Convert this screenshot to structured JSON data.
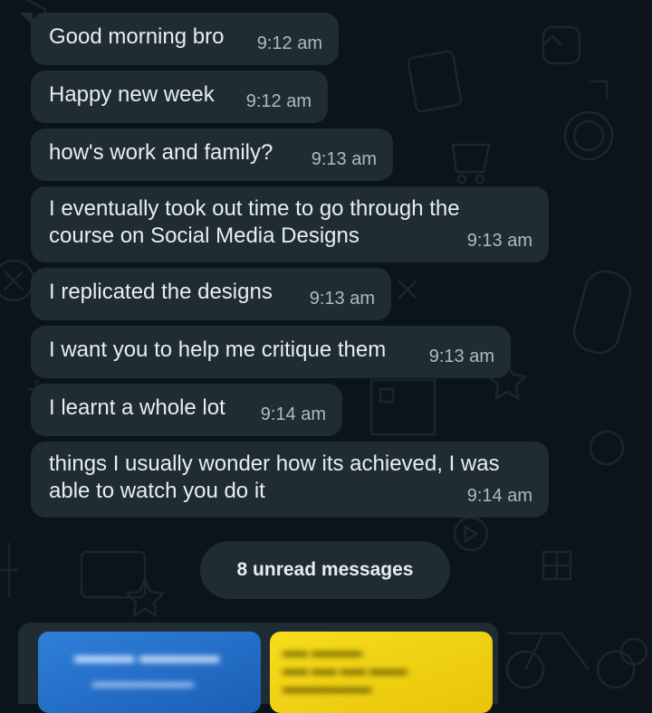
{
  "messages": [
    {
      "text": "Good morning bro",
      "time": "9:12 am"
    },
    {
      "text": "Happy new week",
      "time": "9:12 am"
    },
    {
      "text": "how's work and family?",
      "time": "9:13 am"
    },
    {
      "text": "I eventually took out time to go through the\ncourse on Social Media Designs",
      "time": "9:13 am"
    },
    {
      "text": "I replicated the designs",
      "time": "9:13 am"
    },
    {
      "text": "I want you to help me critique them",
      "time": "9:13 am"
    },
    {
      "text": "I learnt a whole lot",
      "time": "9:14 am"
    },
    {
      "text": "things I usually wonder how its achieved, I was\nable to watch you do it",
      "time": "9:14 am"
    }
  ],
  "unread_banner": "8 unread messages",
  "colors": {
    "background": "#0b141a",
    "bubble": "#1f2c34",
    "text": "#e9edef",
    "timestamp": "#aebac1",
    "thumbnail_blue": "#2f7fd9",
    "thumbnail_yellow": "#f6dd1c"
  },
  "media_thumbnails": [
    "blurred-blue-design-thumbnail",
    "blurred-yellow-design-thumbnail"
  ]
}
